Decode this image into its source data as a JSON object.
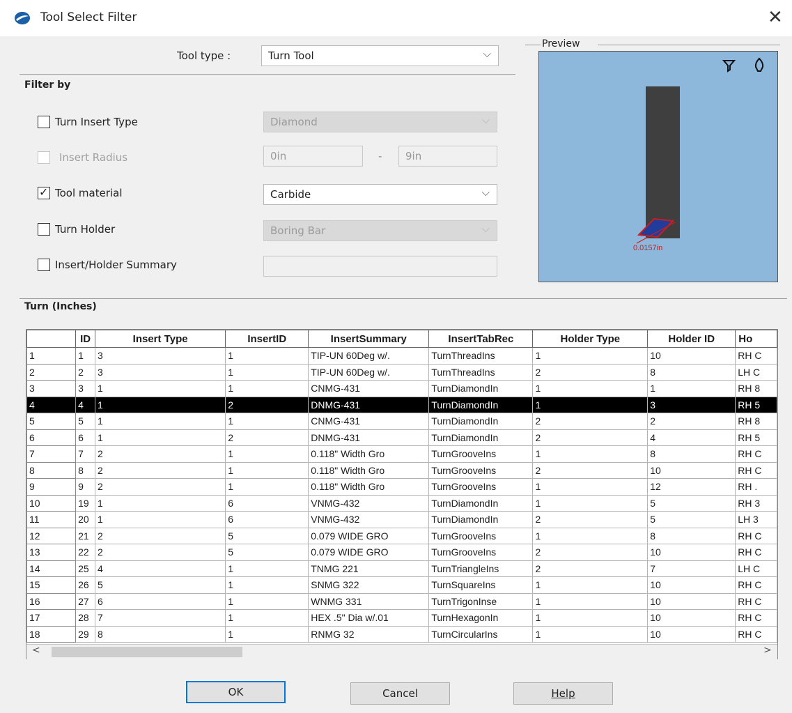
{
  "window": {
    "title": "Tool Select Filter",
    "close_glyph": "✕"
  },
  "tool_type": {
    "label": "Tool type :",
    "value": "Turn Tool"
  },
  "filter_by": {
    "heading": "Filter by",
    "turn_insert_type": {
      "label": "Turn Insert Type",
      "checked": false,
      "value": "Diamond"
    },
    "insert_radius": {
      "label": "Insert Radius",
      "checked": false,
      "min": "0in",
      "separator": "-",
      "max": "9in"
    },
    "tool_material": {
      "label": "Tool material",
      "checked": true,
      "value": "Carbide"
    },
    "turn_holder": {
      "label": "Turn Holder",
      "checked": false,
      "value": "Boring Bar"
    },
    "insert_holder_summary": {
      "label": "Insert/Holder Summary",
      "checked": false,
      "value": ""
    }
  },
  "preview": {
    "label": "Preview",
    "dimension_text": "0.0157in",
    "filter_icon": "filter-icon",
    "tool_icon": "tool-icon"
  },
  "grid": {
    "title": "Turn (Inches)",
    "columns": [
      "",
      "ID",
      "Insert Type",
      "InsertID",
      "InsertSummary",
      "InsertTabRec",
      "Holder Type",
      "Holder ID",
      "Ho"
    ],
    "rows": [
      [
        "1",
        "1",
        "3",
        "1",
        "TIP-UN 60Deg w/.",
        "TurnThreadIns",
        "1",
        "10",
        "RH C"
      ],
      [
        "2",
        "2",
        "3",
        "1",
        "TIP-UN 60Deg w/.",
        "TurnThreadIns",
        "2",
        "8",
        "LH C"
      ],
      [
        "3",
        "3",
        "1",
        "1",
        "CNMG-431",
        "TurnDiamondIn",
        "1",
        "1",
        "RH 8"
      ],
      [
        "4",
        "4",
        "1",
        "2",
        "DNMG-431",
        "TurnDiamondIn",
        "1",
        "3",
        "RH 5"
      ],
      [
        "5",
        "5",
        "1",
        "1",
        "CNMG-431",
        "TurnDiamondIn",
        "2",
        "2",
        "RH 8"
      ],
      [
        "6",
        "6",
        "1",
        "2",
        "DNMG-431",
        "TurnDiamondIn",
        "2",
        "4",
        "RH 5"
      ],
      [
        "7",
        "7",
        "2",
        "1",
        "0.118\" Width Gro",
        "TurnGrooveIns",
        "1",
        "8",
        "RH C"
      ],
      [
        "8",
        "8",
        "2",
        "1",
        "0.118\" Width Gro",
        "TurnGrooveIns",
        "2",
        "10",
        "RH C"
      ],
      [
        "9",
        "9",
        "2",
        "1",
        "0.118\" Width Gro",
        "TurnGrooveIns",
        "1",
        "12",
        "RH ."
      ],
      [
        "10",
        "19",
        "1",
        "6",
        "VNMG-432",
        "TurnDiamondIn",
        "1",
        "5",
        "RH 3"
      ],
      [
        "11",
        "20",
        "1",
        "6",
        "VNMG-432",
        "TurnDiamondIn",
        "2",
        "5",
        "LH 3"
      ],
      [
        "12",
        "21",
        "2",
        "5",
        "0.079 WIDE GRO",
        "TurnGrooveIns",
        "1",
        "8",
        "RH C"
      ],
      [
        "13",
        "22",
        "2",
        "5",
        "0.079 WIDE GRO",
        "TurnGrooveIns",
        "2",
        "10",
        "RH C"
      ],
      [
        "14",
        "25",
        "4",
        "1",
        "TNMG 221",
        "TurnTriangleIns",
        "2",
        "7",
        "LH C"
      ],
      [
        "15",
        "26",
        "5",
        "1",
        "SNMG 322",
        "TurnSquareIns",
        "1",
        "10",
        "RH C"
      ],
      [
        "16",
        "27",
        "6",
        "1",
        "WNMG 331",
        "TurnTrigonInse",
        "1",
        "10",
        "RH C"
      ],
      [
        "17",
        "28",
        "7",
        "1",
        "HEX .5\" Dia w/.01",
        "TurnHexagonIn",
        "1",
        "10",
        "RH C"
      ],
      [
        "18",
        "29",
        "8",
        "1",
        "RNMG 32",
        "TurnCircularIns",
        "1",
        "10",
        "RH C"
      ]
    ],
    "selected_row": 3,
    "scroll_left_glyph": "<",
    "scroll_right_glyph": ">"
  },
  "buttons": {
    "ok": "OK",
    "cancel": "Cancel",
    "help": "Help"
  },
  "colors": {
    "preview_bg": "#8db7db",
    "tool_body": "#3f3f3f",
    "insert_outline": "#cc1d1d",
    "selection": "#000000"
  }
}
